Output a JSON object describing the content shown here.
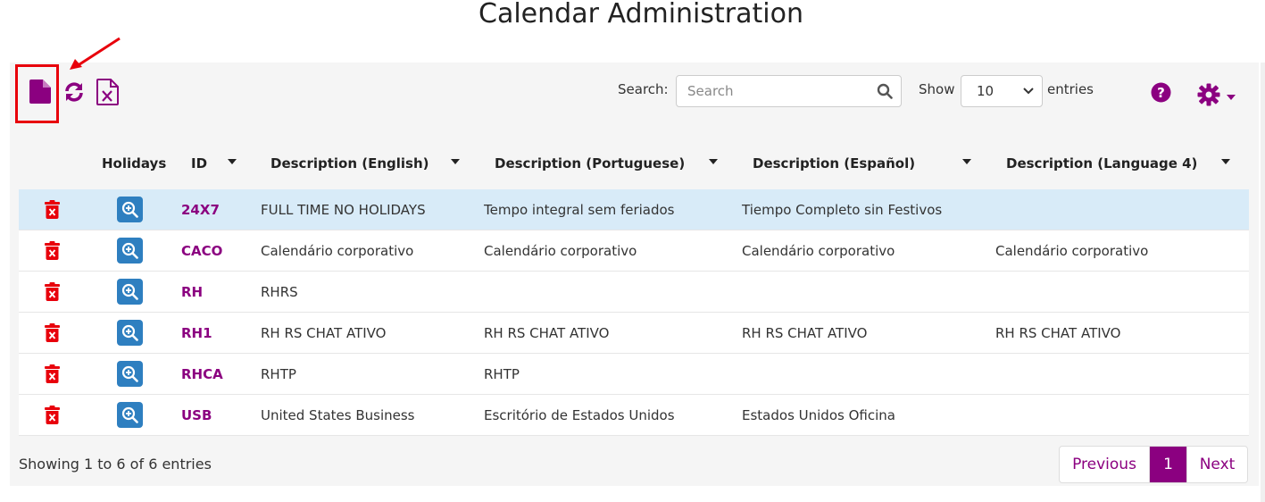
{
  "page": {
    "title": "Calendar Administration"
  },
  "toolbar": {
    "new_icon": "file-icon",
    "refresh_icon": "refresh-icon",
    "excel_icon": "excel-export-icon",
    "search_label": "Search:",
    "search_placeholder": "Search",
    "search_value": "",
    "show_label": "Show",
    "page_size": "10",
    "entries_label": "entries",
    "accent_color": "#8b0080",
    "highlight_color": "#e8000b"
  },
  "table": {
    "columns": [
      "Holidays",
      "ID",
      "Description (English)",
      "Description (Portuguese)",
      "Description (Español)",
      "Description (Language 4)"
    ],
    "rows": [
      {
        "id": "24X7",
        "en": "FULL TIME NO HOLIDAYS",
        "pt": "Tempo integral sem feriados",
        "es": "Tiempo Completo sin Festivos",
        "l4": "",
        "selected": true
      },
      {
        "id": "CACO",
        "en": "Calendário corporativo",
        "pt": "Calendário corporativo",
        "es": "Calendário corporativo",
        "l4": "Calendário corporativo"
      },
      {
        "id": "RH",
        "en": "RHRS",
        "pt": "",
        "es": "",
        "l4": ""
      },
      {
        "id": "RH1",
        "en": "RH RS CHAT ATIVO",
        "pt": "RH RS CHAT ATIVO",
        "es": "RH RS CHAT ATIVO",
        "l4": "RH RS CHAT ATIVO"
      },
      {
        "id": "RHCA",
        "en": "RHTP",
        "pt": "RHTP",
        "es": "",
        "l4": ""
      },
      {
        "id": "USB",
        "en": "United States Business",
        "pt": "Escritório de Estados Unidos",
        "es": "Estados Unidos Oficina",
        "l4": ""
      }
    ]
  },
  "footer": {
    "info": "Showing 1 to 6 of 6 entries",
    "previous": "Previous",
    "current_page": "1",
    "next": "Next"
  }
}
